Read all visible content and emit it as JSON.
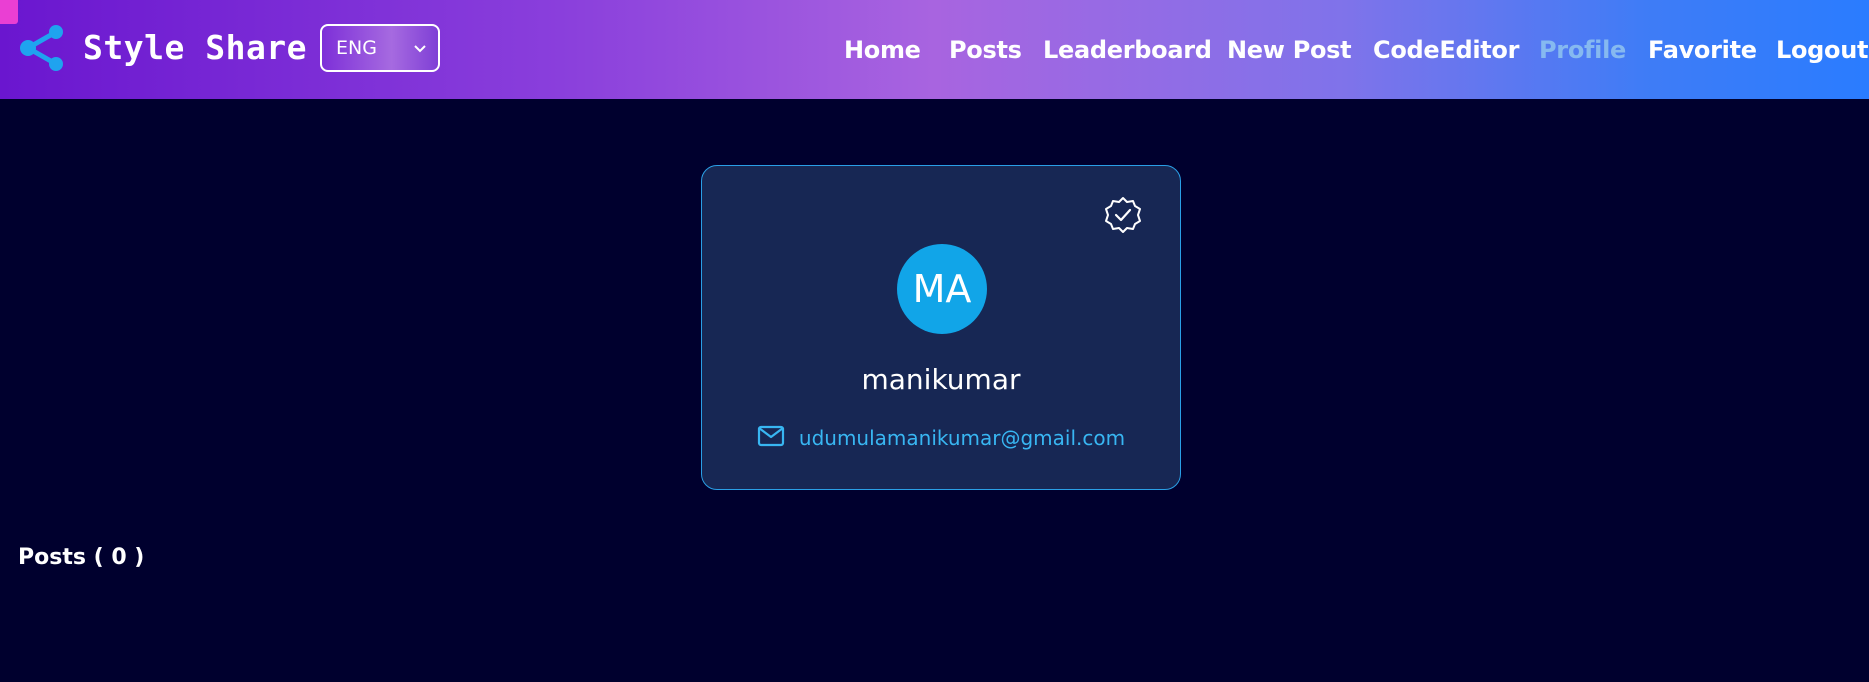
{
  "header": {
    "brand": "Style Share",
    "language": {
      "selected": "ENG"
    },
    "nav": [
      {
        "label": "Home",
        "active": false
      },
      {
        "label": "Posts",
        "active": false
      },
      {
        "label": "Leaderboard",
        "active": false
      },
      {
        "label": "New Post",
        "active": false
      },
      {
        "label": "CodeEditor",
        "active": false
      },
      {
        "label": "Profile",
        "active": true
      },
      {
        "label": "Favorite",
        "active": false
      },
      {
        "label": "Logout",
        "active": false
      }
    ]
  },
  "profile": {
    "initials": "MA",
    "username": "manikumar",
    "email": "udumulamanikumar@gmail.com",
    "verified_icon": "verified-badge-icon",
    "mail_icon": "mail-icon"
  },
  "posts": {
    "heading": "Posts ( 0 )"
  },
  "colors": {
    "page_background": "#00002e",
    "card_background": "#172754",
    "card_border": "#2a9fe6",
    "avatar": "#11a5e8",
    "email_link": "#38b6f2",
    "active_nav": "#86b9f0",
    "header_gradient_start": "#6a16cf",
    "header_gradient_end": "#2a7cff"
  }
}
